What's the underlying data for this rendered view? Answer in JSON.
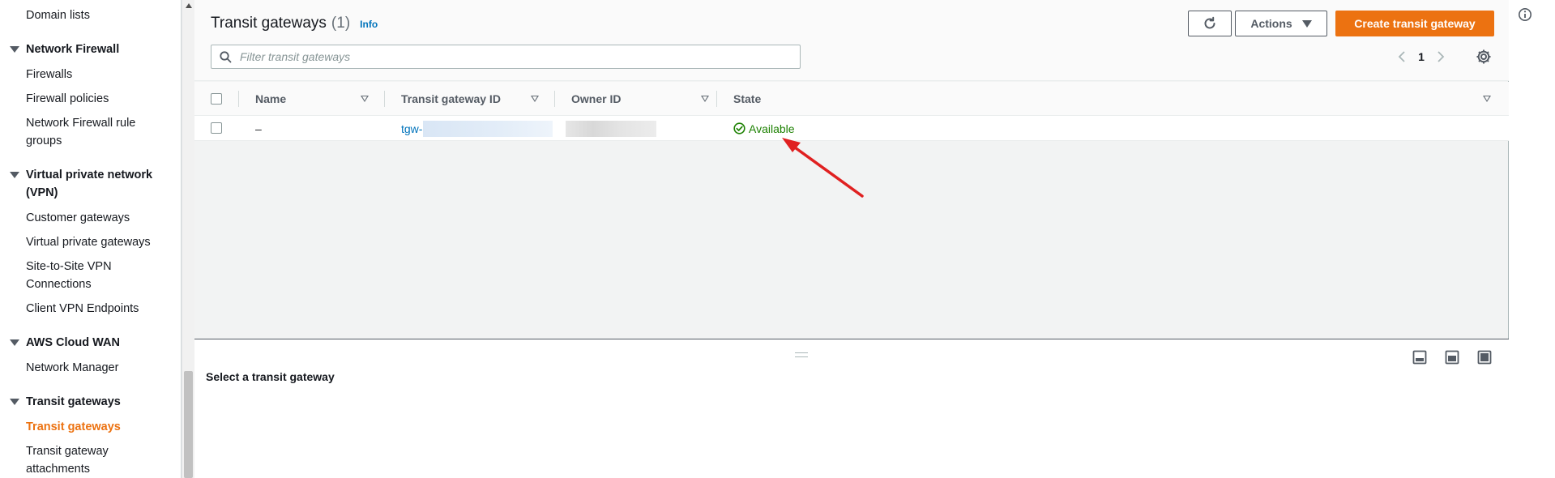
{
  "sidebar": {
    "top_item": "Domain lists",
    "network_firewall": {
      "label": "Network Firewall",
      "items": [
        "Firewalls",
        "Firewall policies",
        "Network Firewall rule groups"
      ]
    },
    "vpn": {
      "label": "Virtual private network (VPN)",
      "items": [
        "Customer gateways",
        "Virtual private gateways",
        "Site-to-Site VPN Connections",
        "Client VPN Endpoints"
      ]
    },
    "cloud_wan": {
      "label": "AWS Cloud WAN",
      "items": [
        "Network Manager"
      ]
    },
    "transit": {
      "label": "Transit gateways",
      "items": [
        "Transit gateways",
        "Transit gateway attachments"
      ],
      "active_index": 0
    }
  },
  "header": {
    "title": "Transit gateways",
    "count": "(1)",
    "info": "Info",
    "actions_label": "Actions",
    "create_label": "Create transit gateway"
  },
  "search": {
    "placeholder": "Filter transit gateways"
  },
  "pagination": {
    "current_page": "1"
  },
  "table": {
    "columns": [
      "Name",
      "Transit gateway ID",
      "Owner ID",
      "State"
    ],
    "rows": [
      {
        "name": "–",
        "id_prefix": "tgw-",
        "owner_id": "",
        "state": "Available"
      }
    ]
  },
  "split_panel": {
    "message": "Select a transit gateway"
  },
  "colors": {
    "accent": "#ec7211",
    "link": "#0073bb",
    "success": "#1d8102",
    "annotation_arrow": "#e02020"
  }
}
